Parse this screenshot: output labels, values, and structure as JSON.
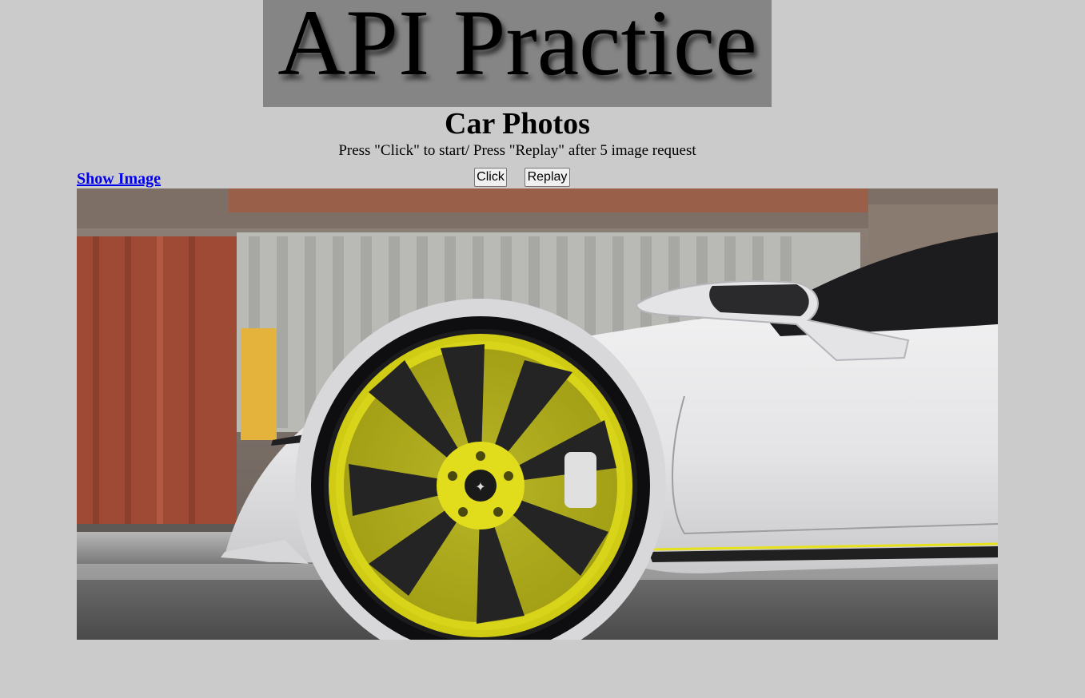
{
  "banner": {
    "title": "API Practice"
  },
  "heading": {
    "title": "Car Photos"
  },
  "instructions": "Press \"Click\" to start/ Press \"Replay\" after 5 image request",
  "link": {
    "show_image": "Show Image"
  },
  "buttons": {
    "click": "Click",
    "replay": "Replay"
  },
  "colors": {
    "page_background": "#cbcbcb",
    "banner_background": "#858585",
    "link": "#0000ee",
    "wheel": "#e6e21a",
    "car_body": "#e9e9ea"
  },
  "image": {
    "subject": "white sports car with yellow wheel, side view near shipping containers"
  }
}
